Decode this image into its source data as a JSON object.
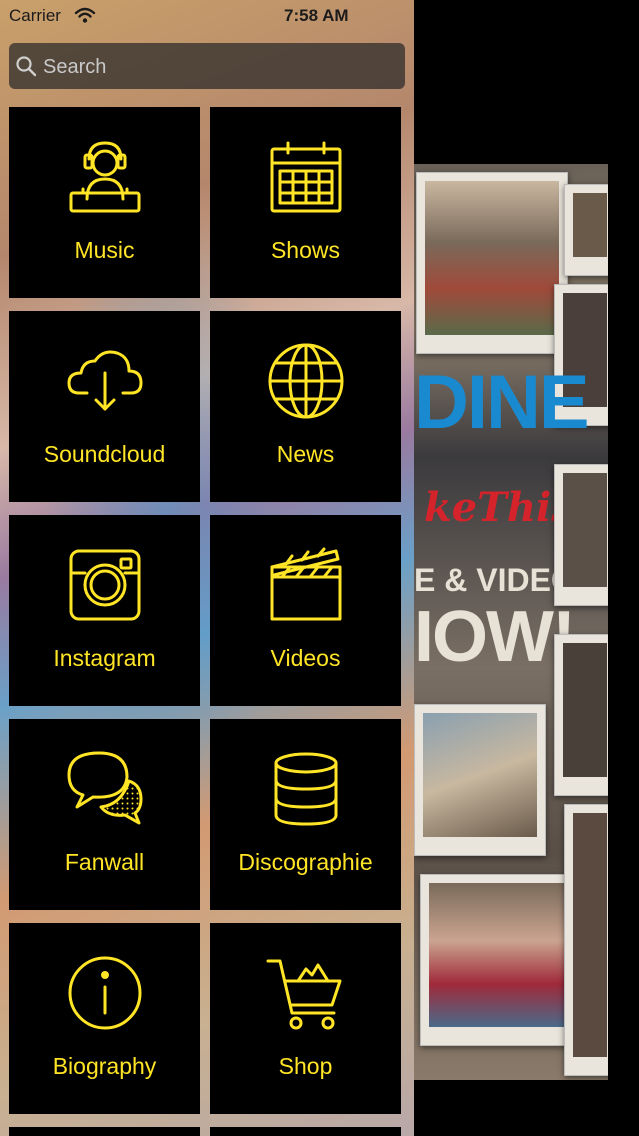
{
  "status_bar": {
    "carrier": "Carrier",
    "time": "7:58 AM"
  },
  "search": {
    "placeholder": "Search"
  },
  "menu": {
    "items": [
      {
        "label": "Music",
        "icon": "dj-headphones-icon"
      },
      {
        "label": "Shows",
        "icon": "calendar-icon"
      },
      {
        "label": "Soundcloud",
        "icon": "cloud-download-icon"
      },
      {
        "label": "News",
        "icon": "globe-icon"
      },
      {
        "label": "Instagram",
        "icon": "camera-icon"
      },
      {
        "label": "Videos",
        "icon": "clapperboard-icon"
      },
      {
        "label": "Fanwall",
        "icon": "speech-bubbles-icon"
      },
      {
        "label": "Discographie",
        "icon": "database-icon"
      },
      {
        "label": "Biography",
        "icon": "info-icon"
      },
      {
        "label": "Shop",
        "icon": "shopping-cart-icon"
      }
    ]
  },
  "background_promo": {
    "line1": "DINE",
    "line2": "keThis",
    "line3": "E & VIDEO",
    "line4": "IOW!"
  },
  "colors": {
    "accent": "#ffe526",
    "tile_bg": "#000000"
  }
}
